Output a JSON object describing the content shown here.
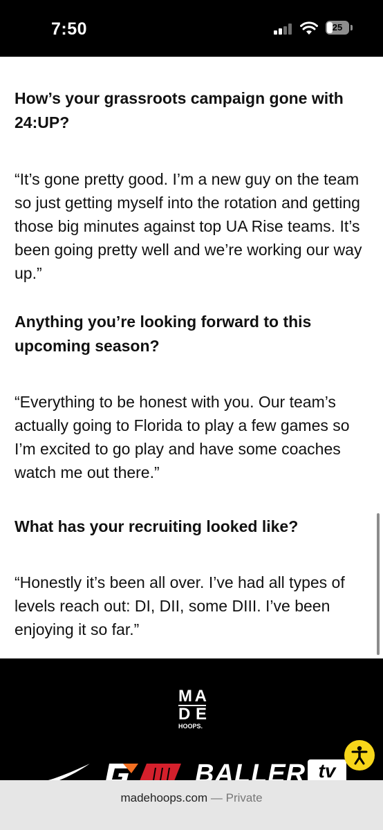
{
  "status_bar": {
    "time": "7:50",
    "battery": "25",
    "battery_fraction": 0.25,
    "icons": [
      "signal-icon",
      "wifi-icon",
      "battery-icon"
    ]
  },
  "article": {
    "q1": "How’s your grassroots campaign gone with 24:UP?",
    "a1": "“It’s gone pretty good. I’m a new guy on the team so just getting myself into the rotation and getting those big minutes against top UA Rise teams. It’s been going pretty well and we’re working our way up.”",
    "q2": "Anything you’re looking forward to this upcoming season?",
    "a2": "“Everything to be honest with you. Our team’s actually going to Florida to play a few games so I’m excited to go play and have some coaches watch me out there.”",
    "q3": "What has your recruiting looked like?",
    "a3": "“Honestly it’s been all over. I’ve had all types of levels reach out: DI, DII, some DIII. I’ve been enjoying it so far.”"
  },
  "footer": {
    "logo_letters": [
      "M",
      "A",
      "D",
      "E"
    ],
    "logo_sub": "HOOPS.",
    "sponsor_text": "BALLER",
    "sponsor_tv": "tv",
    "sponsor_icons": [
      "nike-swoosh-icon",
      "gatorade-g-icon",
      "wilson-w-icon"
    ]
  },
  "url_bar": {
    "domain": "madehoops.com",
    "separator": " — ",
    "mode": "Private"
  },
  "colors": {
    "status_bg": "#000000",
    "footer_bg": "#000000",
    "gatorade_orange": "#f36f21",
    "wilson_red": "#d4202c",
    "accessibility_yellow": "#f7d61a"
  }
}
